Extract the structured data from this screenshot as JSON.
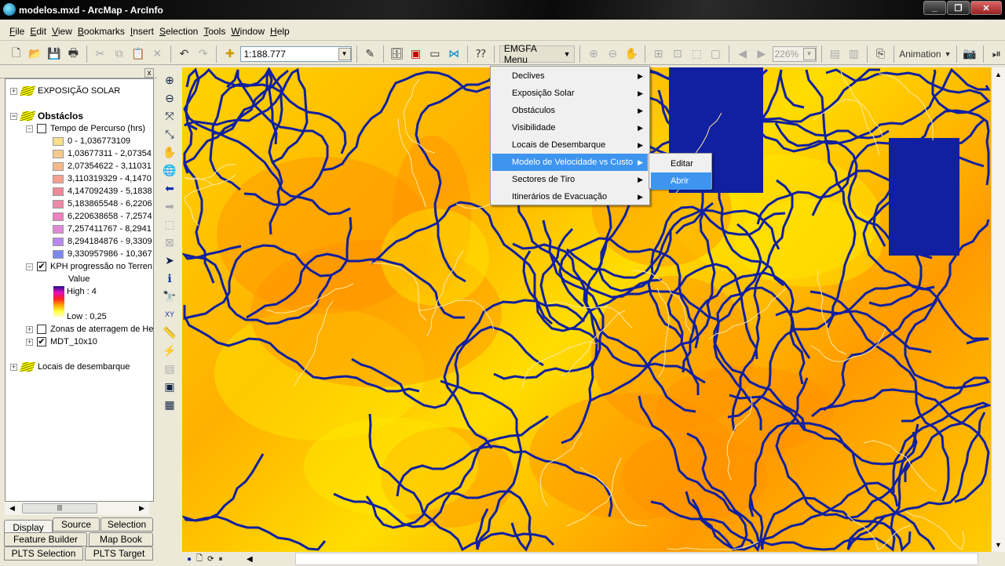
{
  "window": {
    "title": "modelos.mxd - ArcMap - ArcInfo"
  },
  "menubar": [
    "File",
    "Edit",
    "View",
    "Bookmarks",
    "Insert",
    "Selection",
    "Tools",
    "Window",
    "Help"
  ],
  "toolbar": {
    "scale": "1:188.777",
    "emgfa_menu": "EMGFA Menu",
    "zoom_level": "226%",
    "animation": "Animation"
  },
  "toc": {
    "groups": [
      {
        "label": "EXPOSIÇÃO SOLAR"
      },
      {
        "label": "Obstáclos"
      },
      {
        "label": "Locais de desembarque"
      }
    ],
    "tempo": {
      "label": "Tempo de Percurso (hrs)",
      "classes": [
        {
          "label": "0 - 1,036773109",
          "color": "#f7df8a"
        },
        {
          "label": "1,03677311 - 2,07354",
          "color": "#f7c98a"
        },
        {
          "label": "2,07354622 - 3,11031",
          "color": "#f7b98a"
        },
        {
          "label": "3,110319329 - 4,1470",
          "color": "#f7a090"
        },
        {
          "label": "4,147092439 - 5,1838",
          "color": "#f08898"
        },
        {
          "label": "5,183865548 - 6,2206",
          "color": "#f088a8"
        },
        {
          "label": "6,220638658 - 7,2574",
          "color": "#f080c0"
        },
        {
          "label": "7,257411767 - 8,2941",
          "color": "#e088d8"
        },
        {
          "label": "8,294184876 - 9,3309",
          "color": "#b888f0"
        },
        {
          "label": "9,330957986 - 10,367",
          "color": "#7888f0"
        }
      ]
    },
    "kph": {
      "label": "KPH progressão no Terren",
      "value_label": "Value",
      "high": "High : 4",
      "low": "Low : 0,25"
    },
    "zonas": "Zonas de aterragem de He",
    "mdt": "MDT_10x10"
  },
  "tabs": [
    "Display",
    "Source",
    "Selection",
    "Feature Builder",
    "Map Book",
    "PLTS Selection",
    "PLTS Target"
  ],
  "emgfa_menu": {
    "items": [
      "Declives",
      "Exposição Solar",
      "Obstáculos",
      "Visibilidade",
      "Locais de Desembarque",
      "Modelo de Velocidade vs Custo",
      "Sectores de Tiro",
      "Itinerários de Evacuação"
    ],
    "highlighted": "Modelo de Velocidade vs Custo",
    "submenu": [
      "Editar",
      "Abrir"
    ],
    "submenu_highlighted": "Abrir"
  },
  "colors": {
    "highlight": "#3d95f0",
    "network": "#1020a0",
    "terrain": "#ffc800"
  }
}
